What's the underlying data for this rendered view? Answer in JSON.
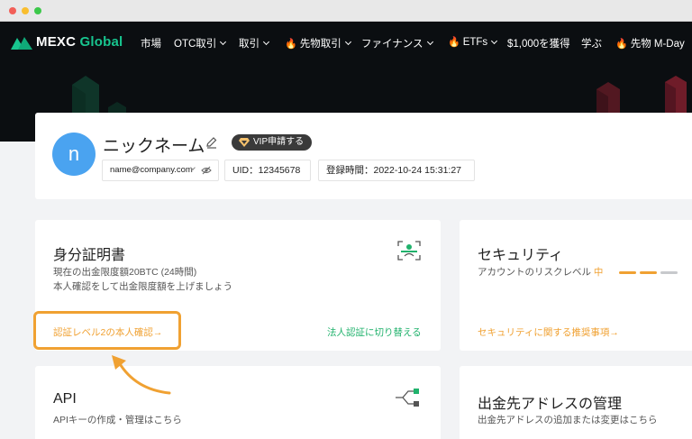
{
  "nav": {
    "brand_main": "MEXC",
    "brand_accent": "Global",
    "items": [
      {
        "label": "市場",
        "chevron": false,
        "fire": false
      },
      {
        "label": "OTC取引",
        "chevron": true,
        "fire": false
      },
      {
        "label": "取引",
        "chevron": true,
        "fire": false
      },
      {
        "label": "先物取引",
        "chevron": true,
        "fire": true
      },
      {
        "label": "ファイナンス",
        "chevron": true,
        "fire": false
      },
      {
        "label": "ETFs",
        "chevron": true,
        "fire": true
      },
      {
        "label": "$1,000を獲得",
        "chevron": false,
        "fire": false
      },
      {
        "label": "学ぶ",
        "chevron": false,
        "fire": false
      },
      {
        "label": "先物 M-Day",
        "chevron": false,
        "fire": true
      }
    ]
  },
  "profile": {
    "avatar_letter": "n",
    "nickname": "ニックネーム",
    "vip_label": "VIP申請する",
    "email": "name@company.com",
    "uid": "UID：12345678",
    "registered": "登録時間：2022-10-24 15:31:27"
  },
  "identity": {
    "title": "身分証明書",
    "desc_line1": "現在の出金限度額20BTC (24時間)",
    "desc_line2": "本人確認をして出金限度額を上げましょう",
    "verify_link": "認証レベル2の本人確認→",
    "corp_link": "法人認証に切り替える"
  },
  "security": {
    "title": "セキュリティ",
    "risk_label": "アカウントのリスクレベル",
    "risk_value": "中",
    "link": "セキュリティに関する推奨事項→"
  },
  "api": {
    "title": "API",
    "desc": "APIキーの作成・管理はこちら"
  },
  "address": {
    "title": "出金先アドレスの管理",
    "desc": "出金先アドレスの追加または変更はこちら"
  },
  "colors": {
    "accent_green": "#20b26c",
    "accent_orange": "#f0a132",
    "header_bg": "#0b0e11",
    "avatar_blue": "#4aa3f0"
  },
  "icons": [
    "pencil-icon",
    "diamond-icon",
    "eye-off-icon",
    "id-scan-icon",
    "api-branch-icon",
    "curved-arrow-icon"
  ]
}
